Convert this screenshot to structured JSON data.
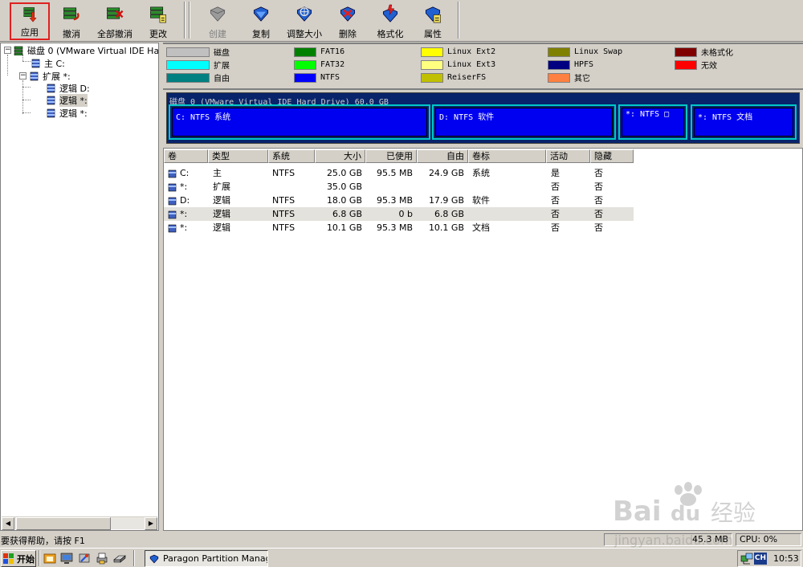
{
  "toolbar": {
    "buttons": [
      {
        "label": "应用",
        "icon": "apply-icon"
      },
      {
        "label": "撤消",
        "icon": "undo-icon"
      },
      {
        "label": "全部撤消",
        "icon": "undo-all-icon"
      },
      {
        "label": "更改",
        "icon": "changes-icon"
      },
      {
        "label": "创建",
        "icon": "create-icon",
        "disabled": true
      },
      {
        "label": "复制",
        "icon": "copy-icon"
      },
      {
        "label": "调整大小",
        "icon": "resize-icon"
      },
      {
        "label": "删除",
        "icon": "delete-icon"
      },
      {
        "label": "格式化",
        "icon": "format-icon"
      },
      {
        "label": "属性",
        "icon": "properties-icon"
      }
    ]
  },
  "tree": {
    "disk": "磁盘 0 (VMware Virtual IDE Hard",
    "primary": "主 C:",
    "extended": "扩展 *:",
    "logical1": "逻辑 D:",
    "logical2": "逻辑 *:",
    "logical3": "逻辑 *:"
  },
  "legend": [
    {
      "label": "磁盘",
      "color": "#c0c0c0"
    },
    {
      "label": "扩展",
      "color": "#00ffff"
    },
    {
      "label": "自由",
      "color": "#008080"
    },
    {
      "label": "FAT16",
      "color": "#008000"
    },
    {
      "label": "FAT32",
      "color": "#00ff00"
    },
    {
      "label": "NTFS",
      "color": "#0000ff"
    },
    {
      "label": "Linux Ext2",
      "color": "#ffff00"
    },
    {
      "label": "Linux Ext3",
      "color": "#ffff80"
    },
    {
      "label": "ReiserFS",
      "color": "#c0c000"
    },
    {
      "label": "Linux Swap",
      "color": "#808000"
    },
    {
      "label": "HPFS",
      "color": "#000080"
    },
    {
      "label": "其它",
      "color": "#ff8040"
    },
    {
      "label": "未格式化",
      "color": "#800000"
    },
    {
      "label": "无效",
      "color": "#ff0000"
    }
  ],
  "diskmap": {
    "title": "磁盘 0 (VMware Virtual IDE Hard Drive) 60.0 GB",
    "partitions": [
      {
        "label": "C: NTFS 系统"
      },
      {
        "label": "D: NTFS 软件"
      },
      {
        "label": "*: NTFS □"
      },
      {
        "label": "*: NTFS 文档"
      }
    ]
  },
  "table": {
    "columns": [
      "卷",
      "类型",
      "系统",
      "大小",
      "已使用",
      "自由",
      "卷标",
      "活动",
      "隐藏"
    ],
    "rows": [
      [
        "C:",
        "主",
        "NTFS",
        "25.0 GB",
        "95.5 MB",
        "24.9 GB",
        "系统",
        "是",
        "否"
      ],
      [
        "*:",
        "扩展",
        "",
        "35.0 GB",
        "",
        "",
        "",
        "否",
        "否"
      ],
      [
        "D:",
        "逻辑",
        "NTFS",
        "18.0 GB",
        "95.3 MB",
        "17.9 GB",
        "软件",
        "否",
        "否"
      ],
      [
        "*:",
        "逻辑",
        "NTFS",
        "6.8 GB",
        "0 b",
        "6.8 GB",
        "",
        "否",
        "否"
      ],
      [
        "*:",
        "逻辑",
        "NTFS",
        "10.1 GB",
        "95.3 MB",
        "10.1 GB",
        "文档",
        "否",
        "否"
      ]
    ]
  },
  "status": {
    "help": "要获得帮助，请按 F1",
    "memory": "45.3 MB",
    "cpu": "CPU: 0%"
  },
  "taskbar": {
    "start": "开始",
    "task": "Paragon Partition Manag...",
    "lang": "CH",
    "clock": "10:53"
  },
  "watermark": {
    "brand": "Bai",
    "brand2": "du",
    "cn": "经验",
    "url": "jingyan.baidu.com"
  }
}
